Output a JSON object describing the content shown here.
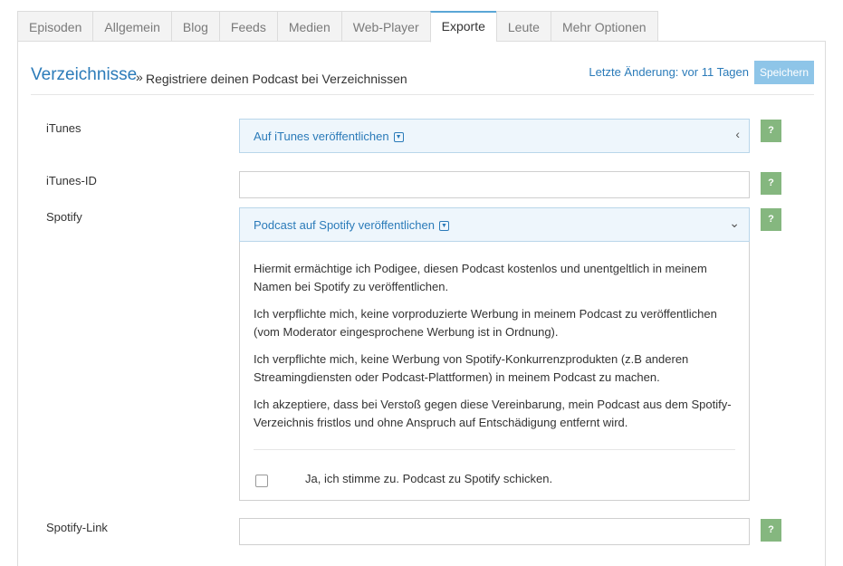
{
  "tabs": [
    {
      "label": "Episoden",
      "active": false
    },
    {
      "label": "Allgemein",
      "active": false
    },
    {
      "label": "Blog",
      "active": false
    },
    {
      "label": "Feeds",
      "active": false
    },
    {
      "label": "Medien",
      "active": false
    },
    {
      "label": "Web-Player",
      "active": false
    },
    {
      "label": "Exporte",
      "active": true
    },
    {
      "label": "Leute",
      "active": false
    },
    {
      "label": "Mehr Optionen",
      "active": false
    }
  ],
  "header": {
    "crumb_link": "Verzeichnisse",
    "crumb_sep": "»",
    "title": "Registriere deinen Podcast bei Verzeichnissen",
    "last_change": "Letzte Änderung: vor 11 Tagen",
    "save_label": "Speichern"
  },
  "fields": {
    "itunes": {
      "label": "iTunes",
      "toggle_text": "Auf iTunes veröffentlichen",
      "chevron": "left-chevron-icon"
    },
    "itunes_id": {
      "label": "iTunes-ID",
      "value": ""
    },
    "spotify": {
      "label": "Spotify",
      "toggle_text": "Podcast auf Spotify veröffentlichen",
      "chevron": "down-chevron-icon",
      "paragraphs": [
        "Hiermit ermächtige ich Podigee, diesen Podcast kostenlos und unentgeltlich in meinem Namen bei Spotify zu veröffentlichen.",
        "Ich verpflichte mich, keine vorproduzierte Werbung in meinem Podcast zu veröffentlichen (vom Moderator eingesprochene Werbung ist in Ordnung).",
        "Ich verpflichte mich, keine Werbung von Spotify-Konkurrenzprodukten (z.B anderen Streamingdiensten oder Podcast-Plattformen) in meinem Podcast zu machen.",
        "Ich akzeptiere, dass bei Verstoß gegen diese Vereinbarung, mein Podcast aus dem Spotify-Verzeichnis fristlos und ohne Anspruch auf Entschädigung entfernt wird."
      ],
      "consent_label": "Ja, ich stimme zu. Podcast zu Spotify schicken.",
      "consent_checked": false
    },
    "spotify_link": {
      "label": "Spotify-Link",
      "value": ""
    }
  },
  "help_label": "?",
  "colors": {
    "accent_link": "#2b7bb9",
    "help_button": "#85b77f",
    "save_button": "#8ec5e8",
    "toggle_bg": "#eef6fc"
  }
}
